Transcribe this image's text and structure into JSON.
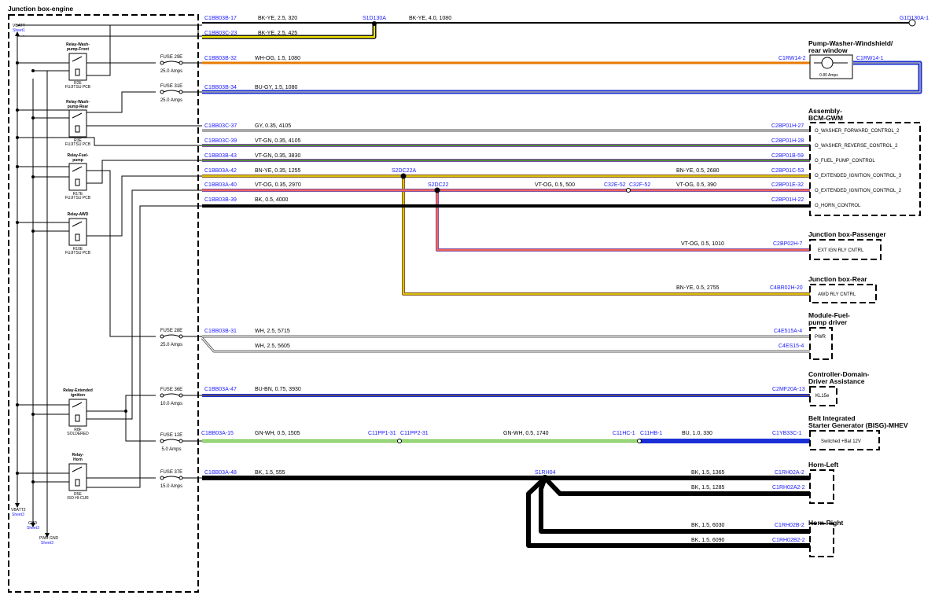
{
  "title": "Junction box-engine",
  "sheet_refs": {
    "vbatt": "VBATT",
    "vbatt_sheet": "Sheet1",
    "vbatt2": "VBATT2",
    "vbatt2_sheet": "Sheet3",
    "gnd": "GND",
    "gnd_sheet": "Sheet3",
    "pwrgnd": "PWR GND",
    "pwrgnd_sheet": "Sheet3"
  },
  "relays": [
    {
      "name": "Relay-Wash-pump-Front",
      "lines": [
        "Relay-Wash-",
        "pump-Front"
      ],
      "code": "R2E",
      "type": "FUJITSU PCB"
    },
    {
      "name": "Relay-Wash-pump-Rear",
      "lines": [
        "Relay-Wash-",
        "pump-Rear"
      ],
      "code": "R3E",
      "type": "FUJITSU PCB"
    },
    {
      "name": "Relay-Fuel-pump",
      "lines": [
        "Relay-Fuel-",
        "pump"
      ],
      "code": "R17E",
      "type": "FUJITSU PCB"
    },
    {
      "name": "Relay-AWD",
      "lines": [
        "Relay-AWD"
      ],
      "code": "R10E",
      "type": "FUJITSU PCB"
    },
    {
      "name": "Relay-Extended ignition",
      "lines": [
        "Relay-Extended",
        "ignition"
      ],
      "code": "R8F",
      "type": "SOLDERED"
    },
    {
      "name": "Relay-Horn",
      "lines": [
        "Relay-",
        "Horn"
      ],
      "code": "R5E",
      "type": "ISO HI-CUR"
    }
  ],
  "fuses": [
    {
      "name": "FUSE 29E",
      "rating": "25.0 Amps"
    },
    {
      "name": "FUSE 31E",
      "rating": "25.0 Amps"
    },
    {
      "name": "FUSE 28E",
      "rating": "25.0 Amps"
    },
    {
      "name": "FUSE 36E",
      "rating": "10.0 Amps"
    },
    {
      "name": "FUSE 12E",
      "rating": "5.0 Amps"
    },
    {
      "name": "FUSE 37E",
      "rating": "15.0 Amps"
    }
  ],
  "wires": [
    {
      "from": "C1BB03B-17",
      "label": "BK-YE, 2.5, 320",
      "color": "#000000",
      "tracer": "#f2e600"
    },
    {
      "splice": "S1D130A",
      "label": "BK-YE, 4.0, 1080",
      "to": "G1D130A-1"
    },
    {
      "from": "C1BB03C-23",
      "label": "BK-YE, 2.5, 425",
      "color": "#000000",
      "tracer": "#f2e600"
    },
    {
      "from": "C1BB03B-32",
      "label": "WH-OG, 1.5, 1080",
      "to": "C1RW14-2",
      "color": "#ffffff",
      "tracer": "#e87a00"
    },
    {
      "from": "C1BB03B-34",
      "label": "BU-GY, 1.5, 1080",
      "to": "C1RW14-1",
      "color": "#1a2fd6",
      "tracer": "#a0a0a0"
    },
    {
      "from": "C1BB03C-37",
      "label": "GY, 0.35, 4105",
      "to": "C2BP01H-27",
      "color": "#a8a8a8"
    },
    {
      "from": "C1BB03C-39",
      "label": "VT-GN, 0.35, 4105",
      "to": "C2BP01H-28",
      "color": "#7d4ea6",
      "tracer": "#38b000"
    },
    {
      "from": "C1BB03B-43",
      "label": "VT-GN, 0.35, 3830",
      "to": "C2BP01B-59",
      "color": "#7d4ea6",
      "tracer": "#38b000"
    },
    {
      "from": "C1BB03A-42",
      "label": "BN-YE, 0.35, 1255",
      "splice": "S2DC22A",
      "label2": "BN-YE, 0.5, 2680",
      "to": "C2BP01C-53",
      "color": "#8b5a2b",
      "tracer": "#f2e600"
    },
    {
      "from": "C1BB03A-40",
      "label": "VT-OG, 0.35, 2970",
      "splice": "S2DC22",
      "label2": "VT-OG, 0.5, 500",
      "inline1": "C32E-52",
      "inline2": "C32F-52",
      "label3": "VT-OG, 0.5, 390",
      "to": "C2BP01E-32",
      "color": "#7d4ea6",
      "tracer": "#e87a00"
    },
    {
      "from": "C1BB03B-39",
      "label": "BK, 0.5, 4000",
      "to": "C2BP01H-22",
      "color": "#000000"
    },
    {
      "label": "VT-OG, 0.5, 1010",
      "to": "C2BP02H-7"
    },
    {
      "label": "BN-YE, 0.5, 2755",
      "to": "C4BR02H-20"
    },
    {
      "from": "C1BB03B-31",
      "label": "WH, 2.5, 5715",
      "to": "C4E515A-4",
      "color": "#ffffff"
    },
    {
      "label": "WH, 2.5, 5605",
      "to": "C4ES15-4",
      "color": "#ffffff"
    },
    {
      "from": "C1BB03A-47",
      "label": "BU-BN, 0.75, 3930",
      "to": "C2MF20A-13",
      "color": "#1a2fd6",
      "tracer": "#8b5a2b"
    },
    {
      "from": "C1BB03A-15",
      "label": "GN-WH, 0.5, 1505",
      "inline1": "C11PP1-31",
      "inline2": "C11PP2-31",
      "label2": "GN-WH, 0.5, 1740",
      "inline3": "C11HC-1",
      "inline4": "C11HB-1",
      "label3": "BU, 1.0, 330",
      "to": "C1YB33C-1"
    },
    {
      "from": "C1BB03A-48",
      "label": "BK, 1.5, 555",
      "splice": "S1RH04",
      "color": "#000000"
    },
    {
      "label": "BK, 1.5, 1365",
      "to": "C1RH02A-2"
    },
    {
      "label": "BK, 1.5, 1285",
      "to": "C1RH02A2-2"
    },
    {
      "label": "BK, 1.5, 6030",
      "to": "C1RH02B-2"
    },
    {
      "label": "BK, 1.5, 6090",
      "to": "C1RH02B2-2"
    }
  ],
  "components": {
    "pump": {
      "name": "Pump-Washer-Windshield/rear window",
      "lines": [
        "Pump-Washer-Windshield/",
        "rear window"
      ],
      "rating": "0.80 Amps"
    },
    "bcm": {
      "name": "Assembly-BCM-GWM",
      "lines": [
        "Assembly-",
        "BCM-GWM"
      ],
      "signals": [
        "O_WASHER_FORWARD_CONTROL_2",
        "O_WASHER_REVERSE_CONTROL_2",
        "O_FUEL_PUMP_CONTROL",
        "O_EXTENDED_IGNITION_CONTROL_3",
        "O_EXTENDED_IGNITION_CONTROL_2",
        "O_HORN_CONTROL"
      ]
    },
    "jb_passenger": {
      "name": "Junction box-Passenger",
      "signal": "EXT IGN RLY CNTRL"
    },
    "jb_rear": {
      "name": "Junction box-Rear",
      "signal": "AWD RLY CNTRL"
    },
    "fuel_pump_driver": {
      "name": "Module-Fuel-pump driver",
      "lines": [
        "Module-Fuel-",
        "pump driver"
      ],
      "signal": "PWR"
    },
    "controller": {
      "name": "Controller-Domain-Driver Assistance",
      "lines": [
        "Controller-Domain-",
        "Driver Assistance"
      ],
      "signal": "KL15e"
    },
    "bisg": {
      "name": "Belt Integrated Starter Generator (BISG)-MHEV",
      "lines": [
        "Belt Integrated",
        "Starter Generator (BISG)-MHEV"
      ],
      "signal": "Switched +Bat 12V"
    },
    "horn_left": {
      "name": "Horn-Left"
    },
    "horn_right": {
      "name": "Horn-Right"
    }
  }
}
